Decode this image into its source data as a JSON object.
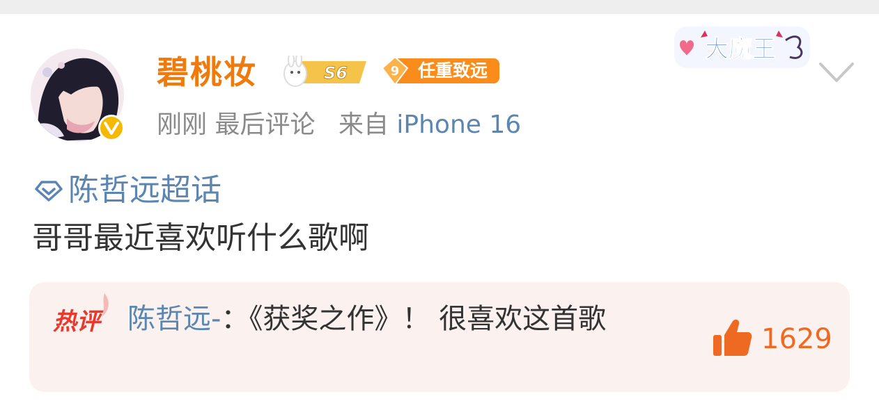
{
  "post": {
    "username": "碧桃妆",
    "level_badge": "S6",
    "fan_level": "9",
    "fan_badge": "任重致远",
    "time": "刚刚",
    "last_comment": "最后评论",
    "source": "来自",
    "device": "iPhone 16",
    "decoration": "大魔王",
    "topic": "陈哲远超话",
    "text": "哥哥最近喜欢听什么歌啊"
  },
  "hot_comment": {
    "tag": "热评",
    "author": "陈哲远-",
    "separator": "：",
    "text": "《获奖之作》！ 很喜欢这首歌",
    "likes": "1629"
  },
  "colors": {
    "username": "#f07a0b",
    "link": "#5b86b2",
    "hot_tag": "#e8392f",
    "like": "#ee6a22",
    "hot_bg": "#fbf1ee"
  },
  "icons": [
    "avatar",
    "verified-v-icon",
    "level-badge-icon",
    "fan-badge-icon",
    "chevron-down-icon",
    "super-topic-icon",
    "hot-comment-tag-icon",
    "thumbs-up-icon"
  ]
}
